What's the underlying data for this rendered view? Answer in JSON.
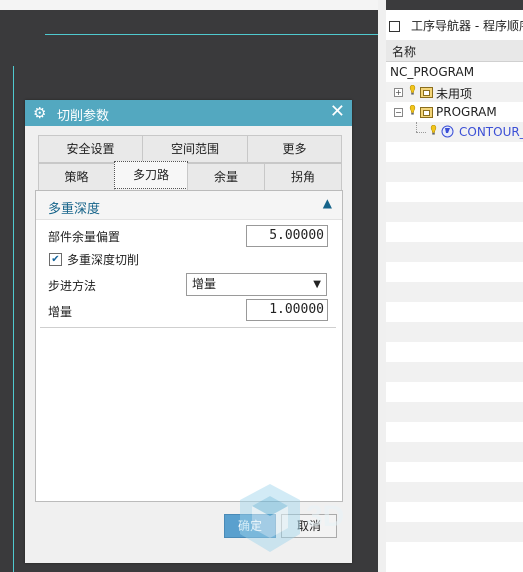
{
  "navigator": {
    "title": "工序导航器 - 程序顺序",
    "column_name": "名称",
    "rows": [
      {
        "label": "NC_PROGRAM"
      },
      {
        "label": "未用项",
        "expander": "+"
      },
      {
        "label": "PROGRAM",
        "expander": "−"
      },
      {
        "label": "CONTOUR_AREA"
      }
    ]
  },
  "dialog": {
    "title": "切削参数",
    "close_glyph": "✕",
    "tabs_row1": [
      "安全设置",
      "空间范围",
      "更多"
    ],
    "tabs_row2": [
      "策略",
      "多刀路",
      "余量",
      "拐角"
    ],
    "active_tab": "多刀路",
    "section": {
      "title": "多重深度",
      "collapse_glyph": "▲",
      "part_stock_label": "部件余量偏置",
      "part_stock_value": "5.00000",
      "multi_depth_checkbox_label": "多重深度切削",
      "multi_depth_checked": true,
      "step_method_label": "步进方法",
      "step_method_value": "增量",
      "increment_label": "增量",
      "increment_value": "1.00000"
    },
    "ok_label": "确定",
    "cancel_label": "取消"
  },
  "colors": {
    "title_bar": "#53a8c0",
    "section_text": "#16648a",
    "program_link": "#3b4fd6",
    "canvas_bg": "#3a3a3c",
    "guide_line": "#4fc9cf"
  },
  "watermark": {
    "text": "3D"
  }
}
